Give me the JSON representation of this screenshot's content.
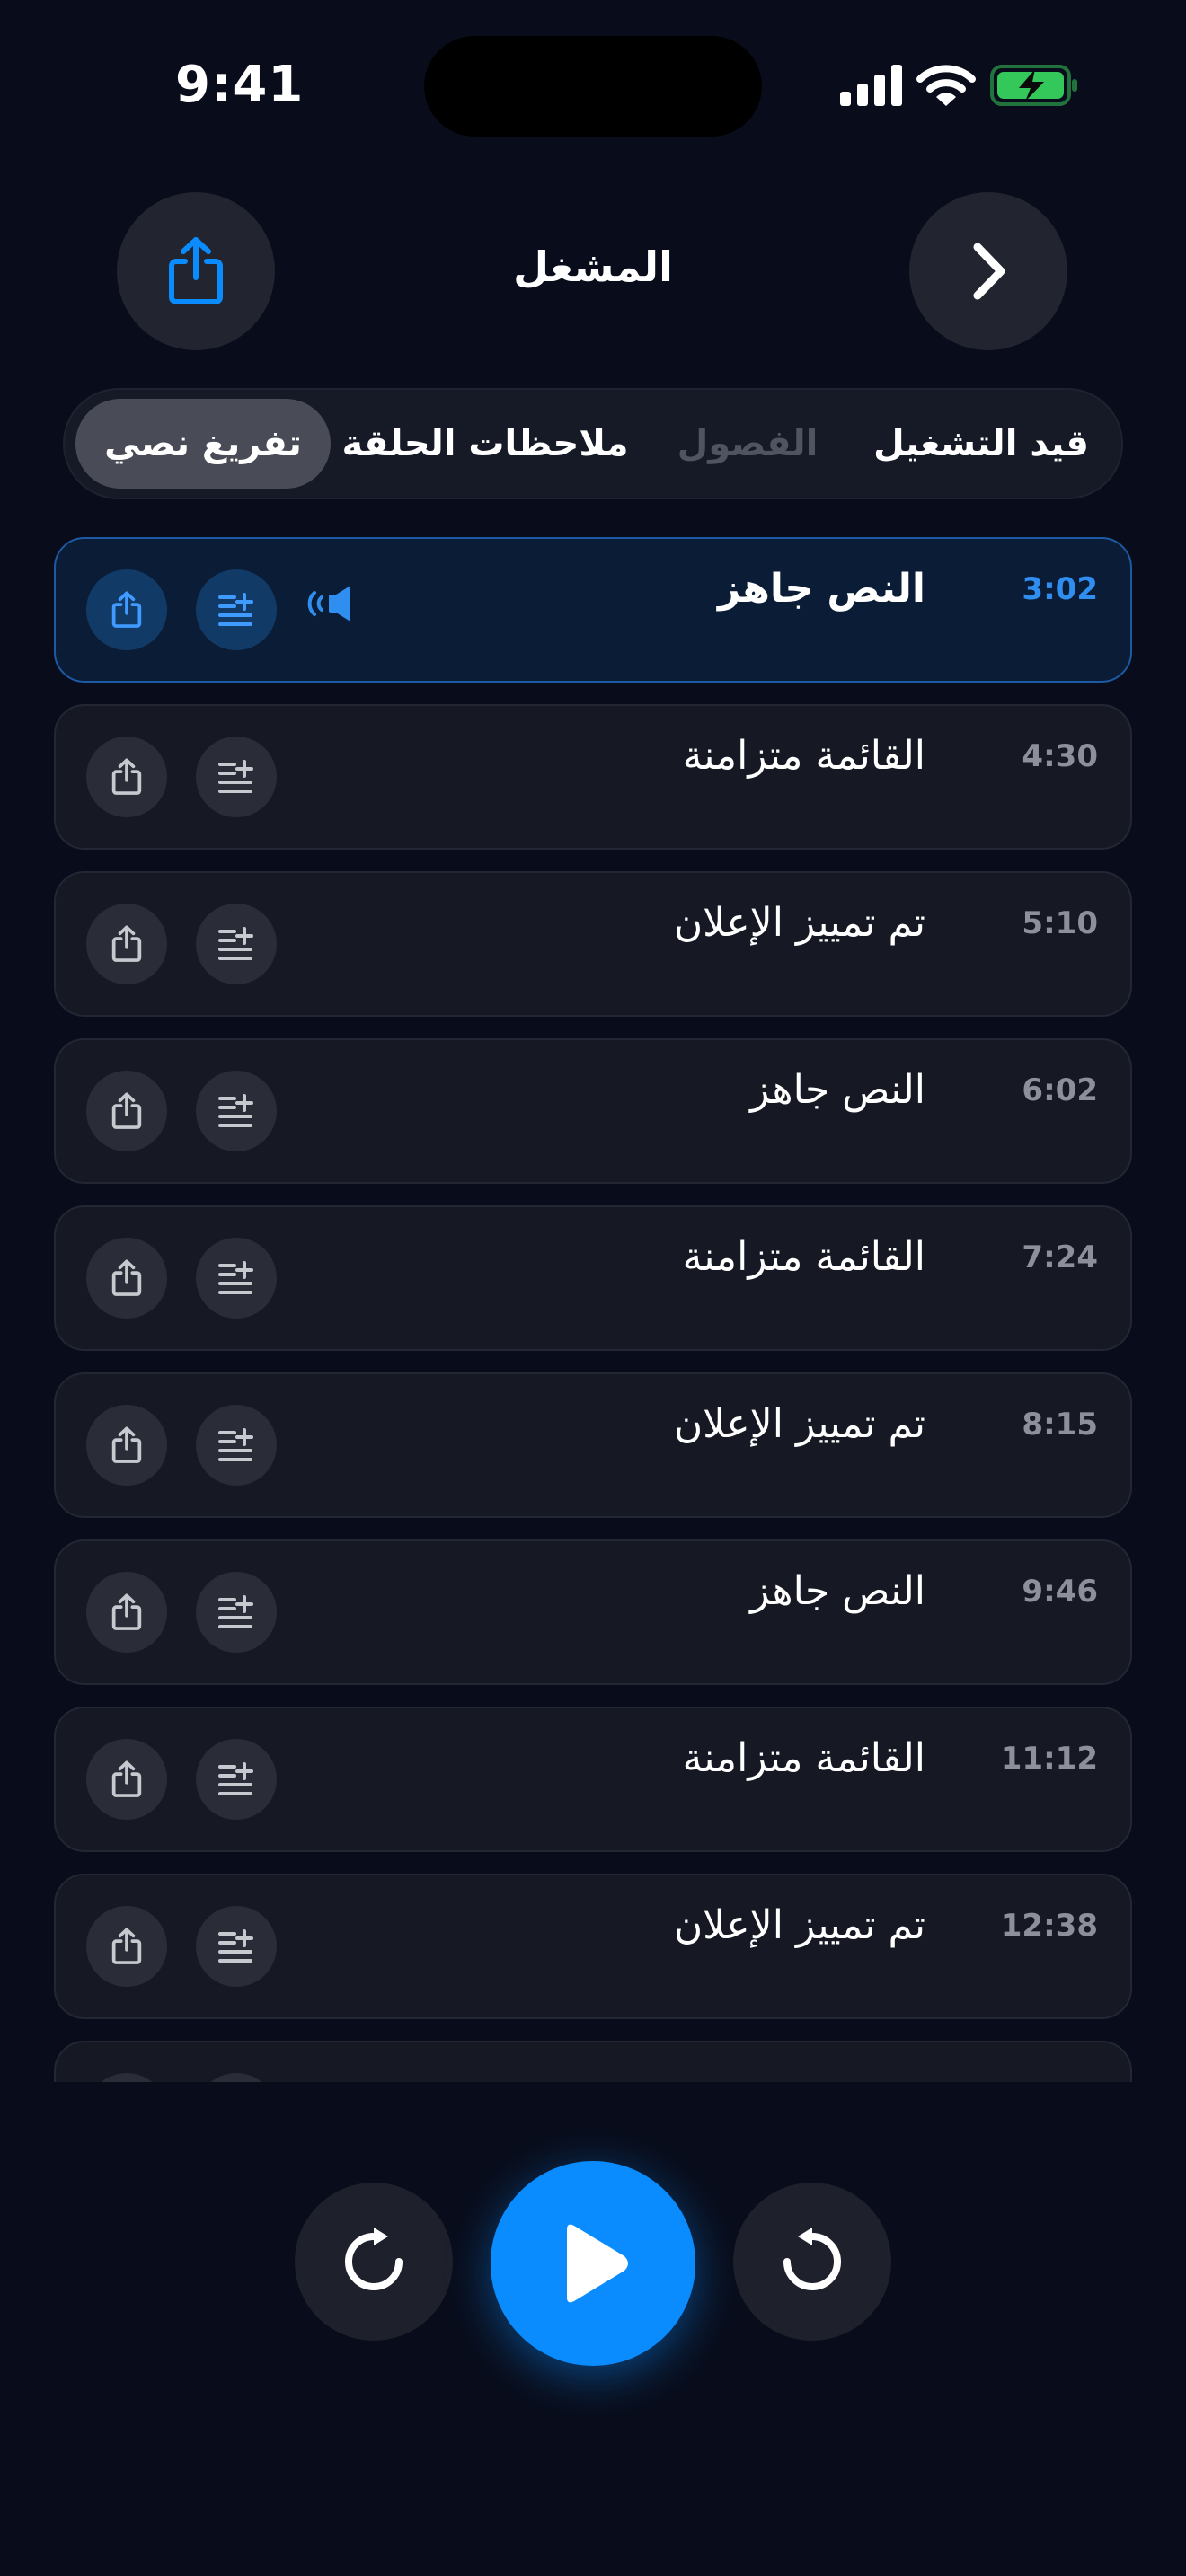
{
  "status": {
    "time": "9:41"
  },
  "header": {
    "title": "المشغل"
  },
  "tabs": [
    {
      "label": "قيد التشغيل",
      "state": "normal"
    },
    {
      "label": "الفصول",
      "state": "disabled"
    },
    {
      "label": "ملاحظات الحلقة",
      "state": "normal"
    },
    {
      "label": "تفريغ نصي",
      "state": "selected"
    }
  ],
  "transcript": [
    {
      "time": "3:02",
      "title": "النص جاهز",
      "active": true
    },
    {
      "time": "4:30",
      "title": "القائمة متزامنة"
    },
    {
      "time": "5:10",
      "title": "تم تمييز الإعلان"
    },
    {
      "time": "6:02",
      "title": "النص جاهز"
    },
    {
      "time": "7:24",
      "title": "القائمة متزامنة"
    },
    {
      "time": "8:15",
      "title": "تم تمييز الإعلان"
    },
    {
      "time": "9:46",
      "title": "النص جاهز"
    },
    {
      "time": "11:12",
      "title": "القائمة متزامنة"
    },
    {
      "time": "12:38",
      "title": "تم تمييز الإعلان"
    }
  ],
  "colors": {
    "accent": "#0a8cff",
    "background": "#090d1b",
    "row": "#161923",
    "battery": "#34c759"
  },
  "icons": {
    "share": "share-icon",
    "back": "chevron-right-icon",
    "queue": "add-to-queue-icon",
    "speaker": "speaker-wave-icon",
    "skip_back": "rewind-icon",
    "skip_forward": "forward-icon",
    "play": "play-icon"
  }
}
